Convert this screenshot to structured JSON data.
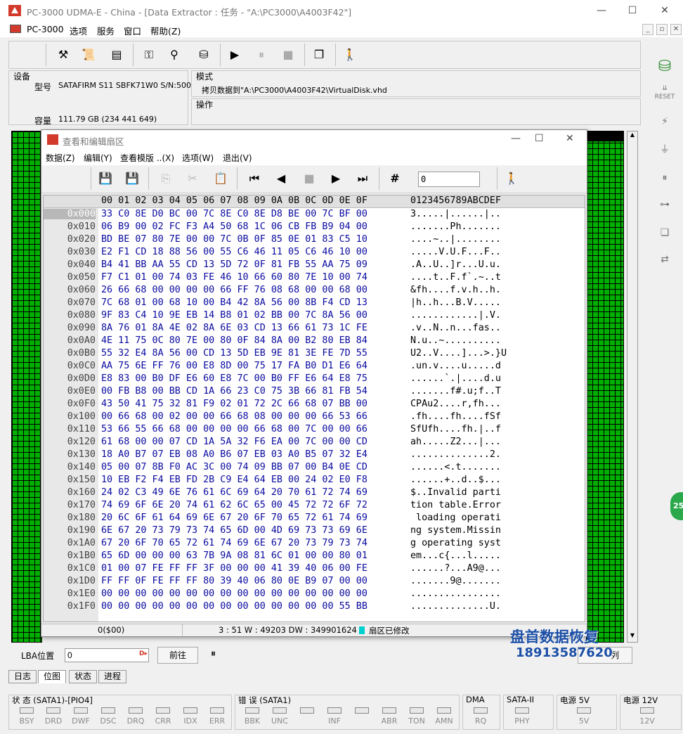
{
  "window": {
    "title": "PC-3000 UDMA-E - China - [Data Extractor : 任务 - \"A:\\PC3000\\A4003F42\"]",
    "minimize": "—",
    "maximize": "☐",
    "close": "✕"
  },
  "menu": [
    "PC-3000",
    "选项",
    "服务",
    "窗口",
    "帮助(Z)"
  ],
  "device": {
    "label": "设备",
    "model_label": "型号",
    "model_value": "SATAFIRM   S11 SBFK71W0 S/N:500",
    "capacity_label": "容量",
    "capacity_value": "111.79 GB (234 441 649)"
  },
  "mode": {
    "label": "模式",
    "value": "拷贝数据到\"A:\\PC3000\\A4003F42\\VirtualDisk.vhd",
    "ops_label": "操作"
  },
  "editor": {
    "title": "查看和编辑扇区",
    "menu": [
      "数据(Z)",
      "编辑(Y)",
      "查看模版 ..(X)",
      "选项(W)",
      "退出(V)"
    ],
    "goto_value": "0",
    "header_hex": "00 01 02 03 04 05 06 07 08 09 0A 0B 0C 0D 0E 0F",
    "header_ascii": "0123456789ABCDEF",
    "rows": [
      {
        "a": "0x000",
        "h": "33 C0 8E D0 BC 00 7C 8E C0 8E D8 BE 00 7C BF 00",
        "t": "3.....|......|.."
      },
      {
        "a": "0x010",
        "h": "06 B9 00 02 FC F3 A4 50 68 1C 06 CB FB B9 04 00",
        "t": ".......Ph......."
      },
      {
        "a": "0x020",
        "h": "BD BE 07 80 7E 00 00 7C 0B 0F 85 0E 01 83 C5 10",
        "t": "....~..|........"
      },
      {
        "a": "0x030",
        "h": "E2 F1 CD 18 88 56 00 55 C6 46 11 05 C6 46 10 00",
        "t": ".....V.U.F...F.."
      },
      {
        "a": "0x040",
        "h": "B4 41 BB AA 55 CD 13 5D 72 0F 81 FB 55 AA 75 09",
        "t": ".A..U..]r...U.u."
      },
      {
        "a": "0x050",
        "h": "F7 C1 01 00 74 03 FE 46 10 66 60 80 7E 10 00 74",
        "t": "....t..F.f`.~..t"
      },
      {
        "a": "0x060",
        "h": "26 66 68 00 00 00 00 66 FF 76 08 68 00 00 68 00",
        "t": "&fh....f.v.h..h."
      },
      {
        "a": "0x070",
        "h": "7C 68 01 00 68 10 00 B4 42 8A 56 00 8B F4 CD 13",
        "t": "|h..h...B.V....."
      },
      {
        "a": "0x080",
        "h": "9F 83 C4 10 9E EB 14 B8 01 02 BB 00 7C 8A 56 00",
        "t": "............|.V."
      },
      {
        "a": "0x090",
        "h": "8A 76 01 8A 4E 02 8A 6E 03 CD 13 66 61 73 1C FE",
        "t": ".v..N..n...fas.."
      },
      {
        "a": "0x0A0",
        "h": "4E 11 75 0C 80 7E 00 80 0F 84 8A 00 B2 80 EB 84",
        "t": "N.u..~.........."
      },
      {
        "a": "0x0B0",
        "h": "55 32 E4 8A 56 00 CD 13 5D EB 9E 81 3E FE 7D 55",
        "t": "U2..V....]...>.}U"
      },
      {
        "a": "0x0C0",
        "h": "AA 75 6E FF 76 00 E8 8D 00 75 17 FA B0 D1 E6 64",
        "t": ".un.v....u.....d"
      },
      {
        "a": "0x0D0",
        "h": "E8 83 00 B0 DF E6 60 E8 7C 00 B0 FF E6 64 E8 75",
        "t": "......`.|....d.u"
      },
      {
        "a": "0x0E0",
        "h": "00 FB B8 00 BB CD 1A 66 23 C0 75 3B 66 81 FB 54",
        "t": ".......f#.u;f..T"
      },
      {
        "a": "0x0F0",
        "h": "43 50 41 75 32 81 F9 02 01 72 2C 66 68 07 BB 00",
        "t": "CPAu2....r,fh..."
      },
      {
        "a": "0x100",
        "h": "00 66 68 00 02 00 00 66 68 08 00 00 00 66 53 66",
        "t": ".fh....fh....fSf"
      },
      {
        "a": "0x110",
        "h": "53 66 55 66 68 00 00 00 00 66 68 00 7C 00 00 66",
        "t": "SfUfh....fh.|..f"
      },
      {
        "a": "0x120",
        "h": "61 68 00 00 07 CD 1A 5A 32 F6 EA 00 7C 00 00 CD",
        "t": "ah.....Z2...|..."
      },
      {
        "a": "0x130",
        "h": "18 A0 B7 07 EB 08 A0 B6 07 EB 03 A0 B5 07 32 E4",
        "t": "..............2."
      },
      {
        "a": "0x140",
        "h": "05 00 07 8B F0 AC 3C 00 74 09 BB 07 00 B4 0E CD",
        "t": "......<.t......."
      },
      {
        "a": "0x150",
        "h": "10 EB F2 F4 EB FD 2B C9 E4 64 EB 00 24 02 E0 F8",
        "t": "......+..d..$..."
      },
      {
        "a": "0x160",
        "h": "24 02 C3 49 6E 76 61 6C 69 64 20 70 61 72 74 69",
        "t": "$..Invalid parti"
      },
      {
        "a": "0x170",
        "h": "74 69 6F 6E 20 74 61 62 6C 65 00 45 72 72 6F 72",
        "t": "tion table.Error"
      },
      {
        "a": "0x180",
        "h": "20 6C 6F 61 64 69 6E 67 20 6F 70 65 72 61 74 69",
        "t": " loading operati"
      },
      {
        "a": "0x190",
        "h": "6E 67 20 73 79 73 74 65 6D 00 4D 69 73 73 69 6E",
        "t": "ng system.Missin"
      },
      {
        "a": "0x1A0",
        "h": "67 20 6F 70 65 72 61 74 69 6E 67 20 73 79 73 74",
        "t": "g operating syst"
      },
      {
        "a": "0x1B0",
        "h": "65 6D 00 00 00 63 7B 9A 08 81 6C 01 00 00 80 01",
        "t": "em...c{...l....."
      },
      {
        "a": "0x1C0",
        "h": "01 00 07 FE FF FF 3F 00 00 00 41 39 40 06 00 FE",
        "t": "......?...A9@..."
      },
      {
        "a": "0x1D0",
        "h": "FF FF 0F FE FF FF 80 39 40 06 80 0E B9 07 00 00",
        "t": ".......9@......."
      },
      {
        "a": "0x1E0",
        "h": "00 00 00 00 00 00 00 00 00 00 00 00 00 00 00 00",
        "t": "................"
      },
      {
        "a": "0x1F0",
        "h": "00 00 00 00 00 00 00 00 00 00 00 00 00 00 55 BB",
        "t": "..............U."
      }
    ],
    "status_offset": "0($00)",
    "status_info": "3 : 51 W : 49203 DW : 349901624",
    "status_modified": "扇区已修改"
  },
  "lba": {
    "label": "LBA位置",
    "value": "0",
    "forward": "前往",
    "pause": "⏸",
    "list_btn": "列"
  },
  "tabs": [
    "日志",
    "位图",
    "状态",
    "进程"
  ],
  "status": {
    "groups": [
      {
        "title": "状 态 (SATA1)-[PIO4]",
        "leds": [
          "BSY",
          "DRD",
          "DWF",
          "DSC",
          "DRQ",
          "CRR",
          "IDX",
          "ERR"
        ]
      },
      {
        "title": "错 误 (SATA1)",
        "leds": [
          "BBK",
          "UNC",
          "",
          "INF",
          "",
          "ABR",
          "TON",
          "AMN"
        ]
      },
      {
        "title": "DMA",
        "leds": [
          "RQ"
        ]
      },
      {
        "title": "SATA-II",
        "leds": [
          "PHY"
        ]
      },
      {
        "title": "电源 5V",
        "leds": [
          "5V"
        ]
      },
      {
        "title": "电源 12V",
        "leds": [
          "12V"
        ]
      }
    ]
  },
  "watermark": {
    "line1": "盘首数据恢复",
    "line2": "18913587620"
  },
  "badge": "25"
}
